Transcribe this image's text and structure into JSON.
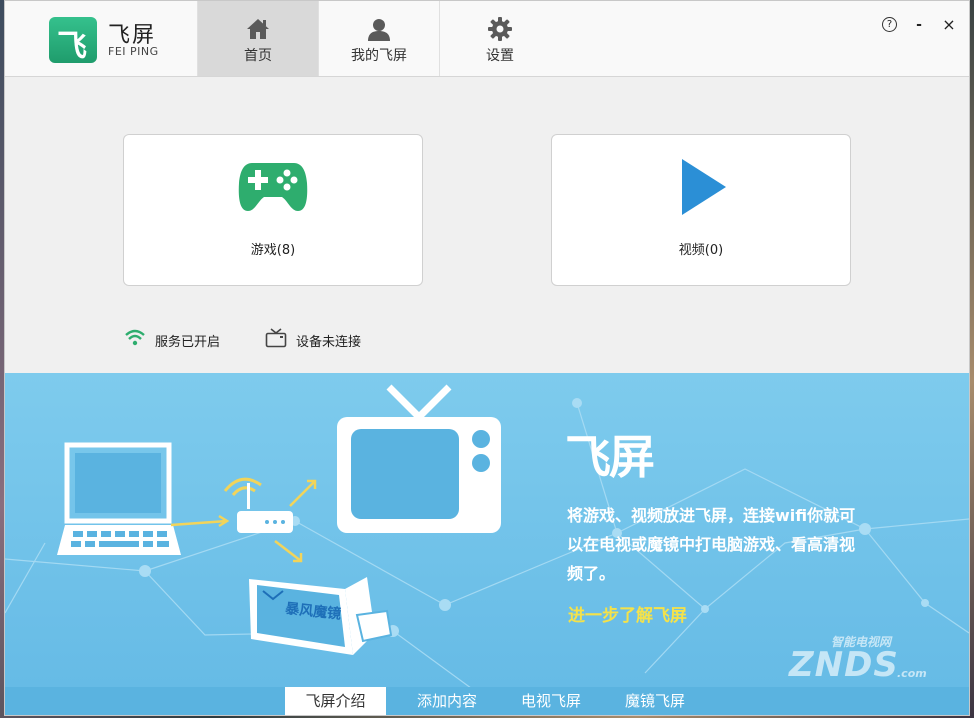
{
  "app": {
    "name_cn": "飞屏",
    "name_en": "FEI PING",
    "logo_glyph": "飞"
  },
  "nav": [
    {
      "label": "首页",
      "icon": "home-icon",
      "active": true
    },
    {
      "label": "我的飞屏",
      "icon": "user-icon",
      "active": false
    },
    {
      "label": "设置",
      "icon": "gear-icon",
      "active": false
    }
  ],
  "window_controls": {
    "help": "?",
    "minimize": "-",
    "close": "×"
  },
  "cards": {
    "games": {
      "label": "游戏(8)",
      "icon": "gamepad-icon"
    },
    "videos": {
      "label": "视频(0)",
      "icon": "play-icon"
    }
  },
  "status": {
    "service": {
      "label": "服务已开启",
      "icon": "wifi-icon"
    },
    "device": {
      "label": "设备未连接",
      "icon": "tv-icon"
    }
  },
  "banner": {
    "title": "飞屏",
    "description": "将游戏、视频放进飞屏，连接wifi你就可以在电视或魔镜中打电脑游戏、看高清视频了。",
    "link": "进一步了解飞屏",
    "vr_label": "暴风魔镜",
    "watermark_cn": "智能电视网",
    "watermark_en": "ZNDS",
    "watermark_suffix": ".com"
  },
  "bottom_tabs": [
    {
      "label": "飞屏介绍",
      "active": true
    },
    {
      "label": "添加内容",
      "active": false
    },
    {
      "label": "电视飞屏",
      "active": false
    },
    {
      "label": "魔镜飞屏",
      "active": false
    }
  ],
  "colors": {
    "accent_green": "#2ead6e",
    "accent_blue": "#2b8fd6",
    "banner_blue": "#72c3ea",
    "link_yellow": "#f4e24a"
  }
}
